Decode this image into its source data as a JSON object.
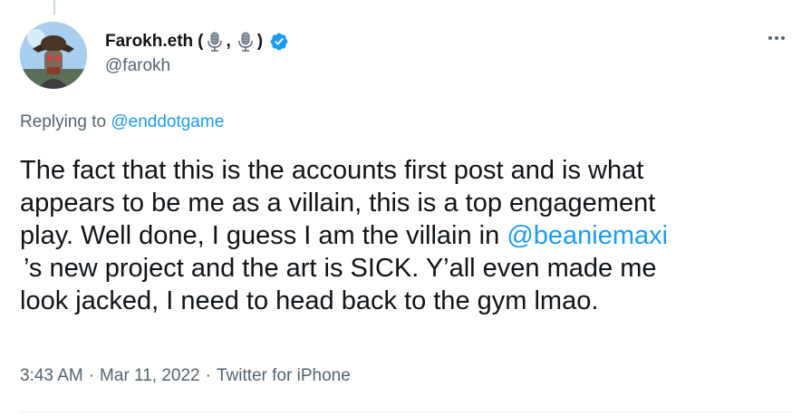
{
  "author": {
    "display_name": "Farokh.eth",
    "paren_open": "(",
    "separator": ",",
    "paren_close": ")",
    "handle": "@farokh",
    "verified": true,
    "icons": [
      "microphone-emoji-icon",
      "microphone-emoji-icon",
      "verified-badge-icon"
    ]
  },
  "reply": {
    "prefix": "Replying to",
    "mention": "@enddotgame"
  },
  "tweet": {
    "line1": "The fact that this is the accounts first post and is what",
    "line2": "appears to be me as a villain, this is a top engagement",
    "line3_text": "play. Well done, I guess I am the villain in ",
    "line3_mention": "@beaniemaxi",
    "line4": "’s new project and the art is SICK. Y’all even made me",
    "line5": "look jacked, I need to head back to the gym lmao."
  },
  "meta": {
    "time": "3:43 AM",
    "dot1": "·",
    "date": "Mar 11, 2022",
    "dot2": "·",
    "source": "Twitter for iPhone"
  },
  "colors": {
    "link": "#1d9bf0",
    "secondary_text": "#536471",
    "verified": "#1d9bf0"
  }
}
